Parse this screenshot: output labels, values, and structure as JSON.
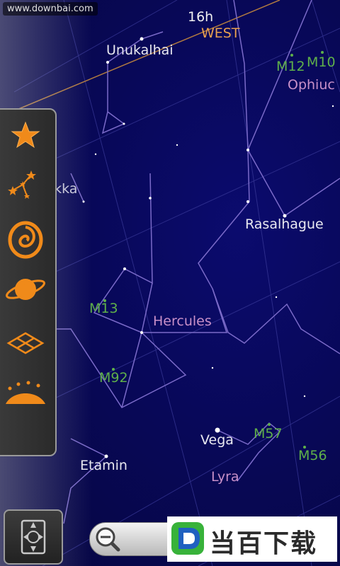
{
  "watermark": "www.downbai.com",
  "sky": {
    "hour_label": "16h",
    "direction_label": "WEST",
    "stars": {
      "unukalhai": "Unukalhai",
      "alphekka": "Alphekka",
      "rasalhague": "Rasalhague",
      "vega": "Vega",
      "etamin": "Etamin"
    },
    "constellations": {
      "hercules": "Hercules",
      "lyra": "Lyra",
      "ophiuchus": "Ophiuc"
    },
    "messier": {
      "m12": "M12",
      "m10": "M10",
      "m13": "M13",
      "m92": "M92",
      "m57": "M57",
      "m56": "M56"
    }
  },
  "layers": [
    {
      "icon": "star-icon"
    },
    {
      "icon": "constellation-icon"
    },
    {
      "icon": "galaxy-icon"
    },
    {
      "icon": "planet-icon"
    },
    {
      "icon": "grid-icon"
    },
    {
      "icon": "horizon-icon"
    }
  ],
  "compass_icon": "compass-icon",
  "zoom_icon": "zoom-out-icon",
  "logo": {
    "letter": "D",
    "text": "当百下载",
    "colors": {
      "green": "#38b23a",
      "blue": "#2060c0"
    }
  },
  "colors": {
    "sky": "#080858",
    "constellation_line": "#7a6ac8",
    "grid_line": "#3a3a9a",
    "ecliptic": "#b07a40",
    "messier": "#5fb04a",
    "direction": "#e8a050",
    "icon_orange": "#f08a1a"
  }
}
